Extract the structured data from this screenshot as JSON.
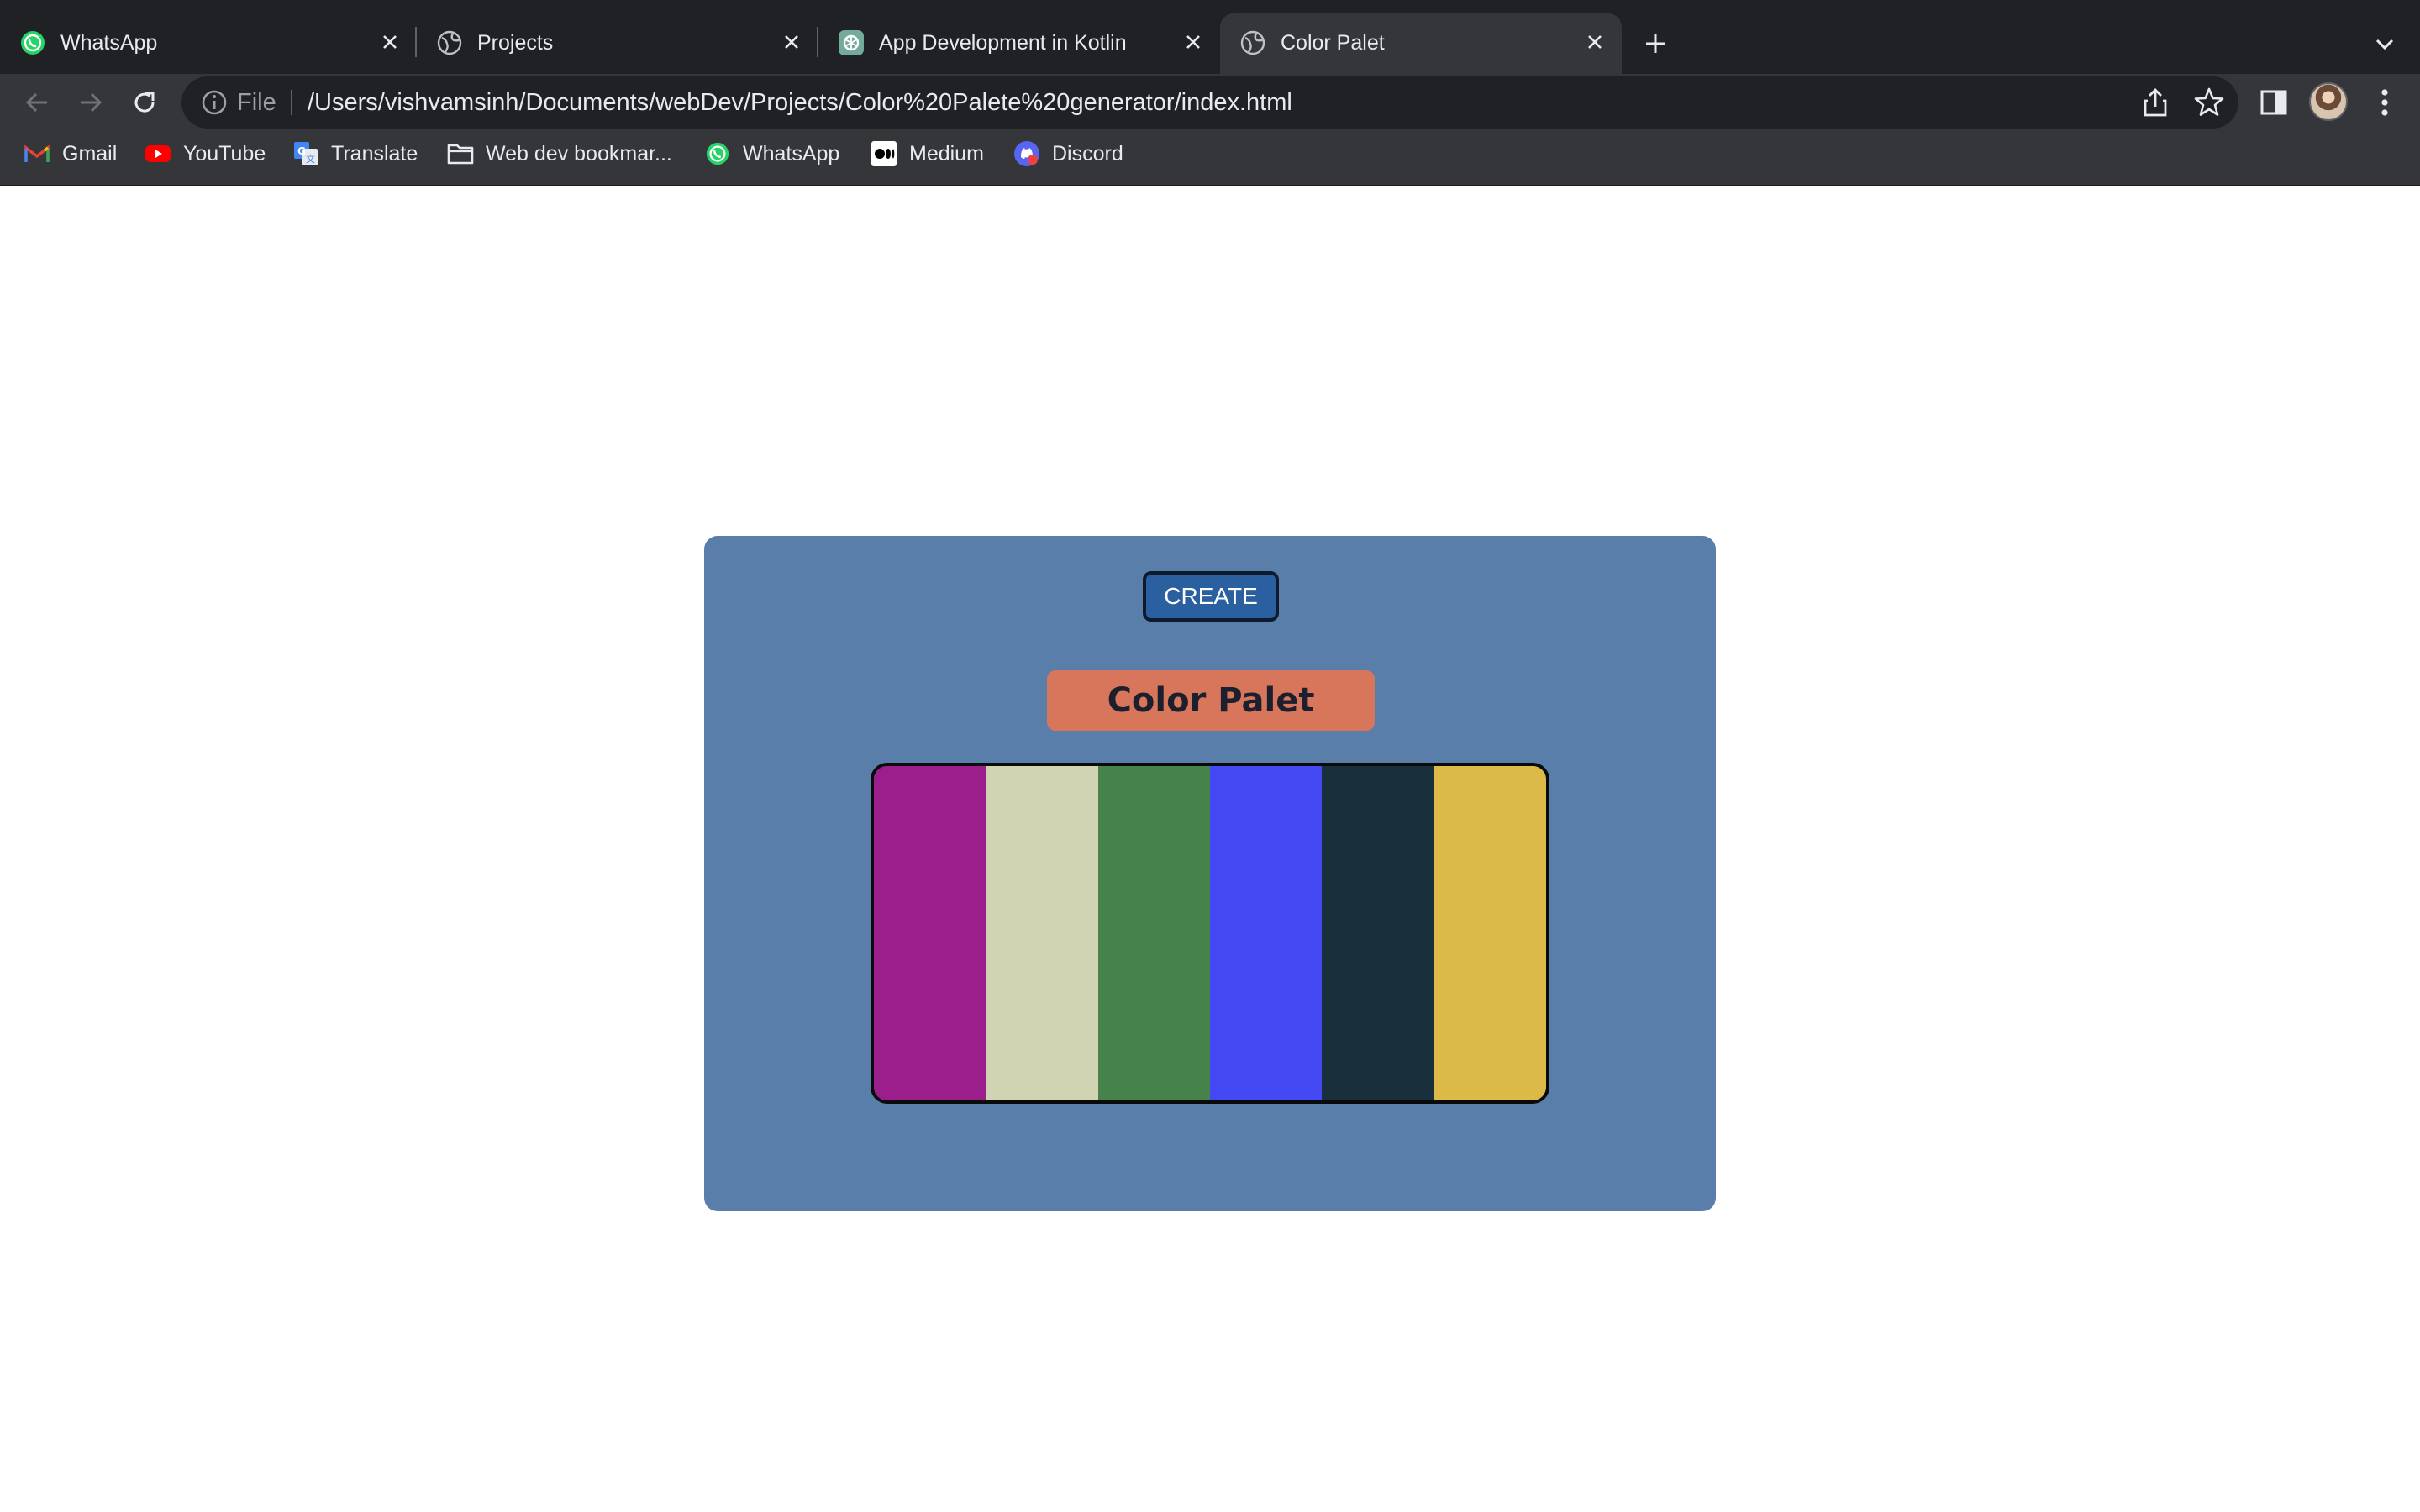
{
  "browser": {
    "tabs": [
      {
        "title": "WhatsApp",
        "icon": "whatsapp-icon",
        "active": false
      },
      {
        "title": "Projects",
        "icon": "globe-icon",
        "active": false
      },
      {
        "title": "App Development in Kotlin",
        "icon": "chatgpt-icon",
        "active": false
      },
      {
        "title": "Color Palet",
        "icon": "globe-icon",
        "active": true
      }
    ],
    "address_bar": {
      "scheme_label": "File",
      "url": "/Users/vishvamsinh/Documents/webDev/Projects/Color%20Palete%20generator/index.html"
    },
    "bookmarks": [
      {
        "label": "Gmail",
        "icon": "gmail-icon"
      },
      {
        "label": "YouTube",
        "icon": "youtube-icon"
      },
      {
        "label": "Translate",
        "icon": "translate-icon"
      },
      {
        "label": "Web dev bookmar...",
        "icon": "folder-icon"
      },
      {
        "label": "WhatsApp",
        "icon": "whatsapp-icon"
      },
      {
        "label": "Medium",
        "icon": "medium-icon"
      },
      {
        "label": "Discord",
        "icon": "discord-icon"
      }
    ]
  },
  "app": {
    "create_label": "CREATE",
    "title": "Color Palet",
    "container_color": "#587ea9",
    "button_color": "#2a5fa0",
    "title_color": "#d7765b",
    "palette": [
      {
        "color": "#9c1d8c"
      },
      {
        "color": "#d1d4b3"
      },
      {
        "color": "#46834a"
      },
      {
        "color": "#4549f3"
      },
      {
        "color": "#1a2f3c"
      },
      {
        "color": "#dcba47"
      }
    ]
  }
}
